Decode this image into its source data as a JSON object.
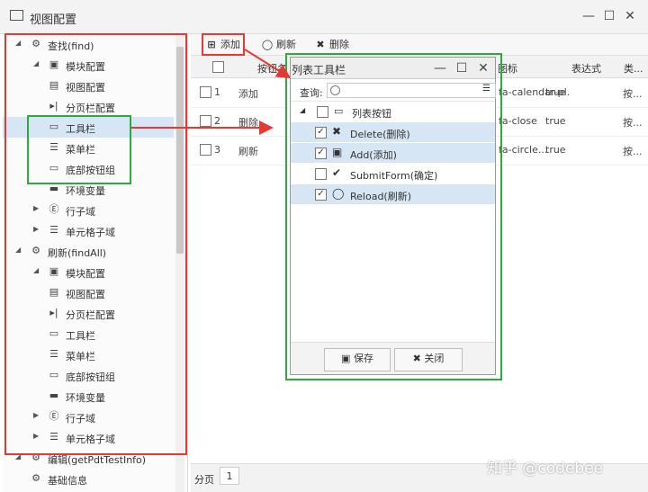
{
  "window": {
    "title": "视图配置"
  },
  "tree": {
    "items": [
      {
        "level": 0,
        "expander": "◢",
        "icon": "gear-icon",
        "glyph": "⚙",
        "label": "查找(find)"
      },
      {
        "level": 1,
        "expander": "◢",
        "icon": "module-icon",
        "glyph": "▣",
        "label": "模块配置"
      },
      {
        "level": 1,
        "expander": "",
        "icon": "view-icon",
        "glyph": "▤",
        "label": "视图配置"
      },
      {
        "level": 1,
        "expander": "",
        "icon": "pager-icon",
        "glyph": "▸|",
        "label": "分页栏配置"
      },
      {
        "level": 1,
        "expander": "",
        "icon": "toolbar-icon",
        "glyph": "▭",
        "label": "工具栏",
        "selected": true
      },
      {
        "level": 1,
        "expander": "",
        "icon": "menu-icon",
        "glyph": "☰",
        "label": "菜单栏"
      },
      {
        "level": 1,
        "expander": "",
        "icon": "bottom-buttons-icon",
        "glyph": "▭",
        "label": "底部按钮组"
      },
      {
        "level": 1,
        "expander": "",
        "icon": "env-icon",
        "glyph": "▬",
        "label": "环境变量"
      },
      {
        "level": 1,
        "expander": "▶",
        "icon": "row-domain-icon",
        "glyph": "Ⓔ",
        "label": "行子域"
      },
      {
        "level": 1,
        "expander": "▶",
        "icon": "cell-domain-icon",
        "glyph": "☰",
        "label": "单元格子域"
      },
      {
        "level": 0,
        "expander": "◢",
        "icon": "gear-icon",
        "glyph": "⚙",
        "label": "刷新(findAll)"
      },
      {
        "level": 1,
        "expander": "◢",
        "icon": "module-icon",
        "glyph": "▣",
        "label": "模块配置"
      },
      {
        "level": 1,
        "expander": "",
        "icon": "view-icon",
        "glyph": "▤",
        "label": "视图配置"
      },
      {
        "level": 1,
        "expander": "",
        "icon": "pager-icon",
        "glyph": "▸|",
        "label": "分页栏配置"
      },
      {
        "level": 1,
        "expander": "",
        "icon": "toolbar-icon",
        "glyph": "▭",
        "label": "工具栏"
      },
      {
        "level": 1,
        "expander": "",
        "icon": "menu-icon",
        "glyph": "☰",
        "label": "菜单栏"
      },
      {
        "level": 1,
        "expander": "",
        "icon": "bottom-buttons-icon",
        "glyph": "▭",
        "label": "底部按钮组"
      },
      {
        "level": 1,
        "expander": "",
        "icon": "env-icon",
        "glyph": "▬",
        "label": "环境变量"
      },
      {
        "level": 1,
        "expander": "▶",
        "icon": "row-domain-icon",
        "glyph": "Ⓔ",
        "label": "行子域"
      },
      {
        "level": 1,
        "expander": "▶",
        "icon": "cell-domain-icon",
        "glyph": "☰",
        "label": "单元格子域"
      },
      {
        "level": 0,
        "expander": "◢",
        "icon": "gear-icon",
        "glyph": "⚙",
        "label": "编辑(getPdtTestInfo)"
      },
      {
        "level": 0,
        "expander": "",
        "icon": "settings-icon",
        "glyph": "⚙",
        "label": "基础信息"
      }
    ]
  },
  "toolbar": {
    "add_label": "添加",
    "refresh_label": "刷新",
    "delete_label": "删除"
  },
  "grid": {
    "headers": [
      "按钮名",
      "图标",
      "表达式",
      "类..."
    ],
    "rows": [
      {
        "no": "1",
        "name": "添加",
        "icon": "fa-calendar-pl...",
        "expr": "true",
        "type": "按..."
      },
      {
        "no": "2",
        "name": "删除",
        "icon": "fa-close",
        "expr": "true",
        "type": "按..."
      },
      {
        "no": "3",
        "name": "刷新",
        "icon": "fa-circle...",
        "expr": "true",
        "type": "按..."
      }
    ]
  },
  "pager": {
    "label": "分页",
    "page": "1"
  },
  "dialog": {
    "title": "列表工具栏",
    "query_label": "查询:",
    "group_label": "列表按钮",
    "items": [
      {
        "label": "Delete(删除)",
        "checked": true,
        "icon": "x-icon",
        "glyph": "✖",
        "selected": true
      },
      {
        "label": "Add(添加)",
        "checked": true,
        "icon": "calendar-plus-icon",
        "glyph": "▣",
        "selected": true
      },
      {
        "label": "SubmitForm(确定)",
        "checked": false,
        "icon": "check-icon",
        "glyph": "✔",
        "selected": false
      },
      {
        "label": "Reload(刷新)",
        "checked": true,
        "icon": "reload-icon",
        "glyph": "◯",
        "selected": true
      }
    ],
    "save_label": "保存",
    "close_label": "关闭"
  },
  "watermark": "知乎 @codebee",
  "colors": {
    "red": "#e53935",
    "green": "#2eaa3c",
    "selected": "#d7e6f4"
  }
}
